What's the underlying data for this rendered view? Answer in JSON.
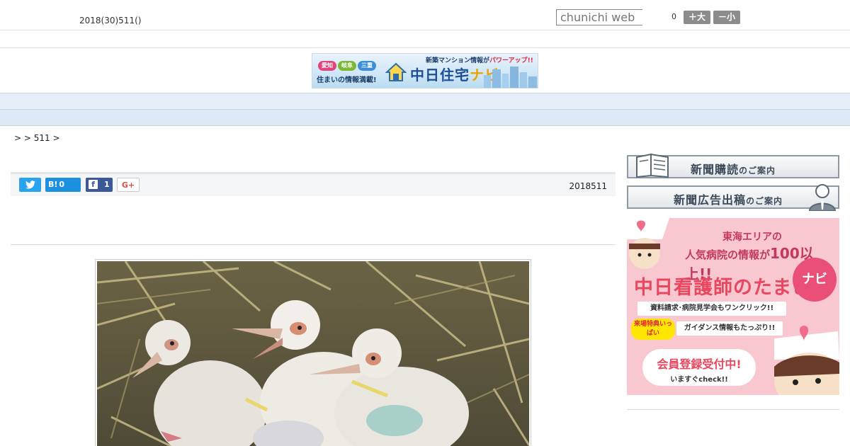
{
  "header": {
    "date_text": "2018(30)511()",
    "search_placeholder": "chunichi web",
    "font_size_value": "0",
    "font_bigger_label": "＋大",
    "font_smaller_label": "－小"
  },
  "banner": {
    "pill_1": "愛知",
    "pill_2": "岐阜",
    "pill_3": "三重",
    "tagline": "住まいの情報満載!",
    "news_prefix": "新築マンション情報が",
    "news_highlight": "パワーアップ!!",
    "brand_1": "中日住宅",
    "brand_2": "ナビ"
  },
  "nav": {
    "items": [
      "　　",
      "　　",
      "　　",
      "　　",
      "　　",
      "　　",
      "　　",
      "　　",
      "　　"
    ]
  },
  "breadcrumb": ">  > 511 >",
  "article": {
    "share": {
      "twitter_icon": "twitter-bird",
      "hatena_label": "B!",
      "hatena_count": "0",
      "facebook_count": "1",
      "gplus_label": "G+"
    },
    "date": "2018511"
  },
  "sidebar": {
    "subscribe_main": "新聞購読",
    "subscribe_sub": "のご案内",
    "ad_main": "新聞広告出稿",
    "ad_sub": "のご案内",
    "nurse_ad": {
      "line1": "東海エリアの",
      "line2_prefix": "人気病院の情報が",
      "line2_big": "100以上!!",
      "title": "中日看護師のたまご",
      "navi": "ナビ",
      "strip1": "資料請求･病院見学会もワンクリック!!",
      "bonus": "来場特典いっぱい",
      "strip2": "ガイダンス情報もたっぷり!!",
      "bubble_main": "会員登録受付中!",
      "bubble_sub": "いますぐcheck!!"
    }
  },
  "colors": {
    "nav_bg": "#e6eff9",
    "twitter": "#2aa3ef",
    "hatena": "#1e90e0",
    "facebook": "#3b5998",
    "nurse_bg": "#f9c7cf"
  }
}
